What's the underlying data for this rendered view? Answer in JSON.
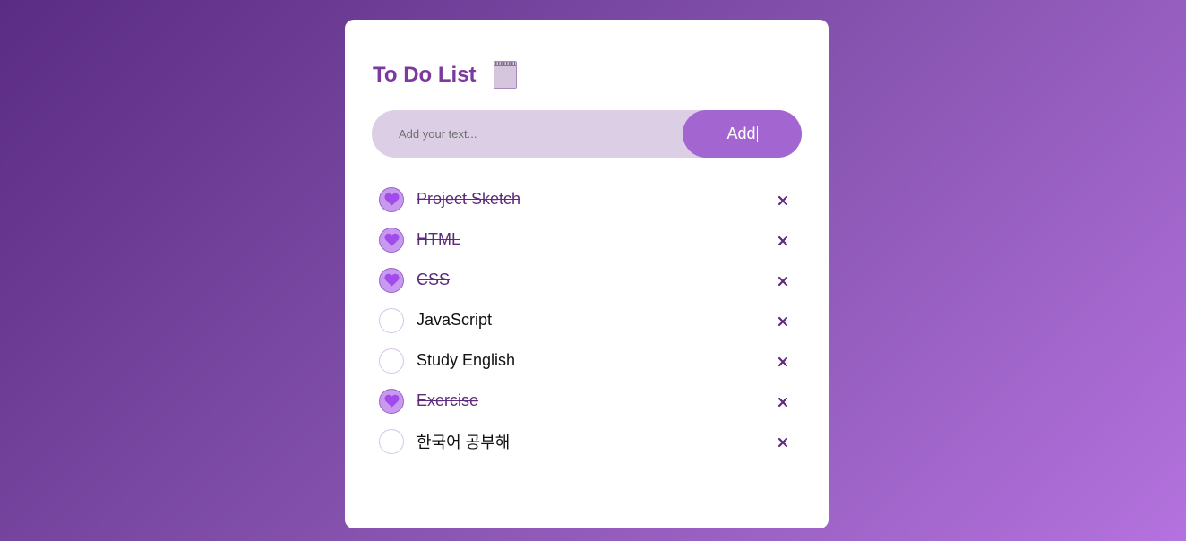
{
  "app": {
    "title": "To Do List",
    "title_icon": "notepad-icon"
  },
  "input": {
    "placeholder": "Add your text...",
    "value": ""
  },
  "add_button": {
    "label": "Add"
  },
  "tasks": [
    {
      "text": "Project Sketch",
      "done": true
    },
    {
      "text": "HTML",
      "done": true
    },
    {
      "text": "CSS",
      "done": true
    },
    {
      "text": "JavaScript",
      "done": false
    },
    {
      "text": "Study English",
      "done": false
    },
    {
      "text": "Exercise",
      "done": true
    },
    {
      "text": "한국어 공부해",
      "done": false
    }
  ],
  "icons": {
    "checked": "heart-icon",
    "delete": "close-icon"
  },
  "colors": {
    "accent": "#a365d0",
    "title": "#7a3a9e",
    "done_text": "#5e2a7e",
    "input_bg": "#dccfe5",
    "check_done_bg": "#c79af0",
    "heart": "#a04bea"
  }
}
